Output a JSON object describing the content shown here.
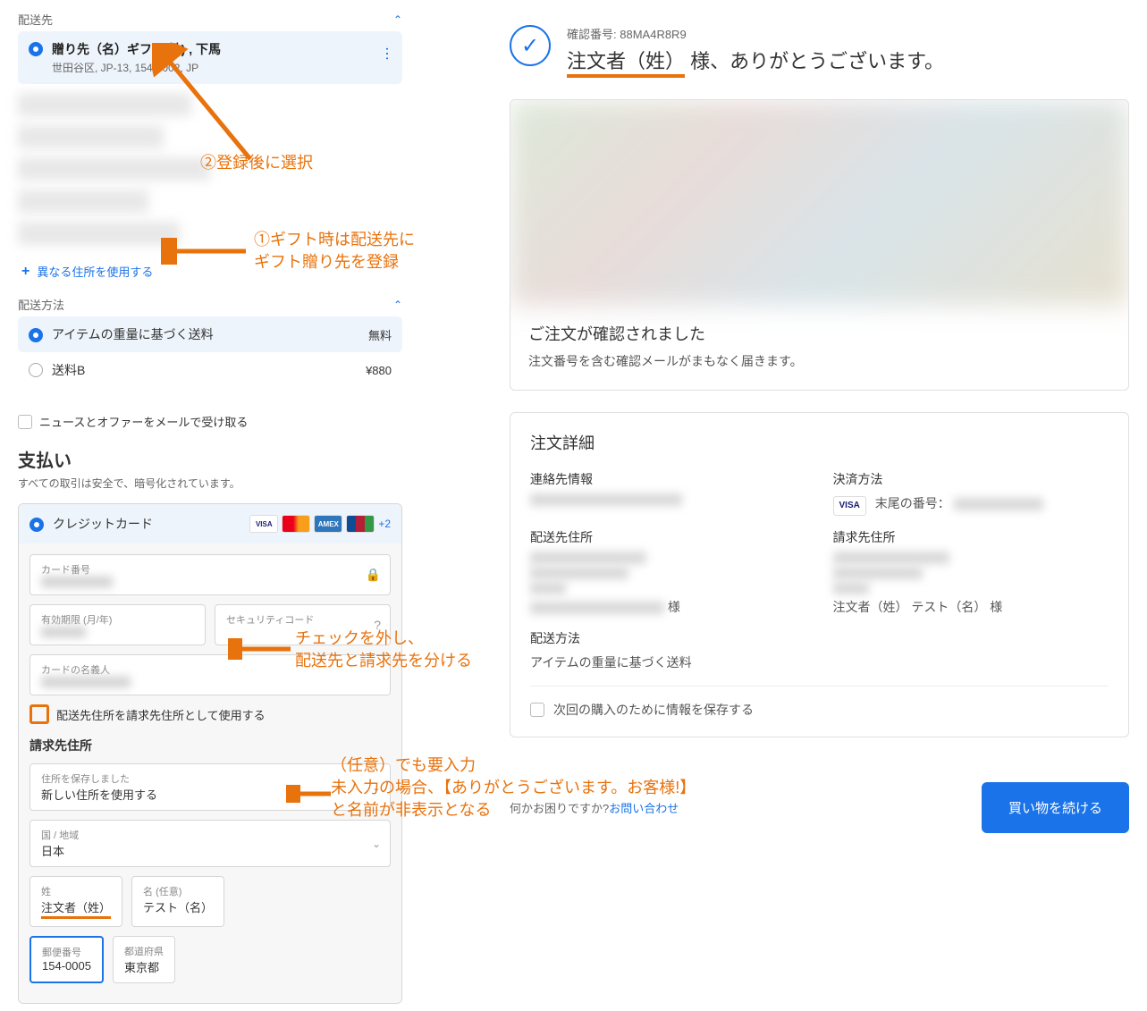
{
  "left": {
    "shipping_dest_label": "配送先",
    "selected_addr": {
      "title": "贈り先（名）ギフト(姓) , 下馬",
      "sub": "世田谷区, JP-13, 154-0002, JP"
    },
    "add_addr": "異なる住所を使用する",
    "shipping_method_label": "配送方法",
    "ship_a": {
      "label": "アイテムの重量に基づく送料",
      "price": "無料"
    },
    "ship_b": {
      "label": "送料B",
      "price": "¥880"
    },
    "newsletter": "ニュースとオファーをメールで受け取る",
    "payment_title": "支払い",
    "payment_sub": "すべての取引は安全で、暗号化されています。",
    "cc_label": "クレジットカード",
    "plus2": "+2",
    "card_num": "カード番号",
    "expiry": "有効期限 (月/年)",
    "cvv": "セキュリティコード",
    "card_name": "カードの名義人",
    "use_ship_as_bill": "配送先住所を請求先住所として使用する",
    "billing_title": "請求先住所",
    "saved_addr_label": "住所を保存しました",
    "new_addr": "新しい住所を使用する",
    "country_label": "国 / 地域",
    "country_val": "日本",
    "surname_label": "姓",
    "surname_val": "注文者（姓）",
    "given_label": "名 (任意)",
    "given_val": "テスト（名）",
    "postal_label": "郵便番号",
    "postal_val": "154-0005",
    "pref_label": "都道府県",
    "pref_val": "東京都"
  },
  "anno": {
    "a1": "②登録後に選択",
    "a2_l1": "①ギフト時は配送先に",
    "a2_l2": "ギフト贈り先を登録",
    "a3_l1": "チェックを外し、",
    "a3_l2": "配送先と請求先を分ける",
    "a4_l1": "（任意）でも要入力",
    "a4_l2": "未入力の場合、【ありがとうございます。お客様!】",
    "a4_l3": "と名前が非表示となる"
  },
  "right": {
    "conf_num_label": "確認番号:",
    "conf_num": "88MA4R8R9",
    "thank_hl": "注文者（姓）",
    "thank_rest": "様、ありがとうございます。",
    "confirmed_title": "ご注文が確認されました",
    "confirmed_sub": "注文番号を含む確認メールがまもなく届きます。",
    "detail_title": "注文詳細",
    "contact_label": "連絡先情報",
    "pay_method_label": "決済方法",
    "pay_tail": "末尾の番号：",
    "ship_addr_label": "配送先住所",
    "bill_addr_label": "請求先住所",
    "ship_name_end": "様",
    "bill_name": "注文者（姓） テスト（名） 様",
    "ship_method_label": "配送方法",
    "ship_method_val": "アイテムの重量に基づく送料",
    "save_info": "次回の購入のために情報を保存する",
    "help_q": "何かお困りですか?",
    "help_link": "お問い合わせ",
    "continue": "買い物を続ける",
    "visa": "VISA"
  }
}
